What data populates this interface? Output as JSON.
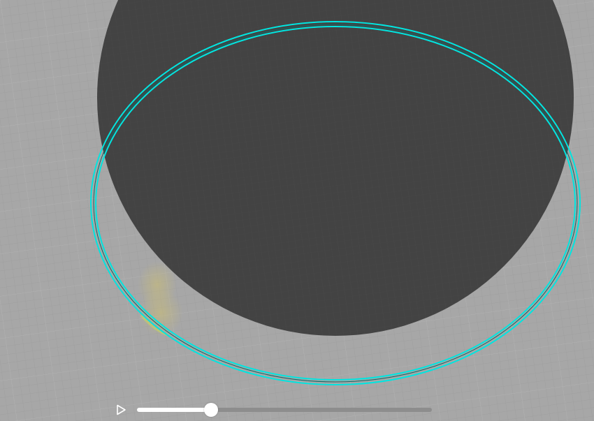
{
  "scene": {
    "background_color": "#a7a7a7",
    "grid_color": "#9c9c9c",
    "disc_color": "#434343",
    "ring_color": "#00e5e0",
    "ghost_color": "#c9b96a"
  },
  "player": {
    "play_icon": "play-icon",
    "progress": 0.25
  }
}
